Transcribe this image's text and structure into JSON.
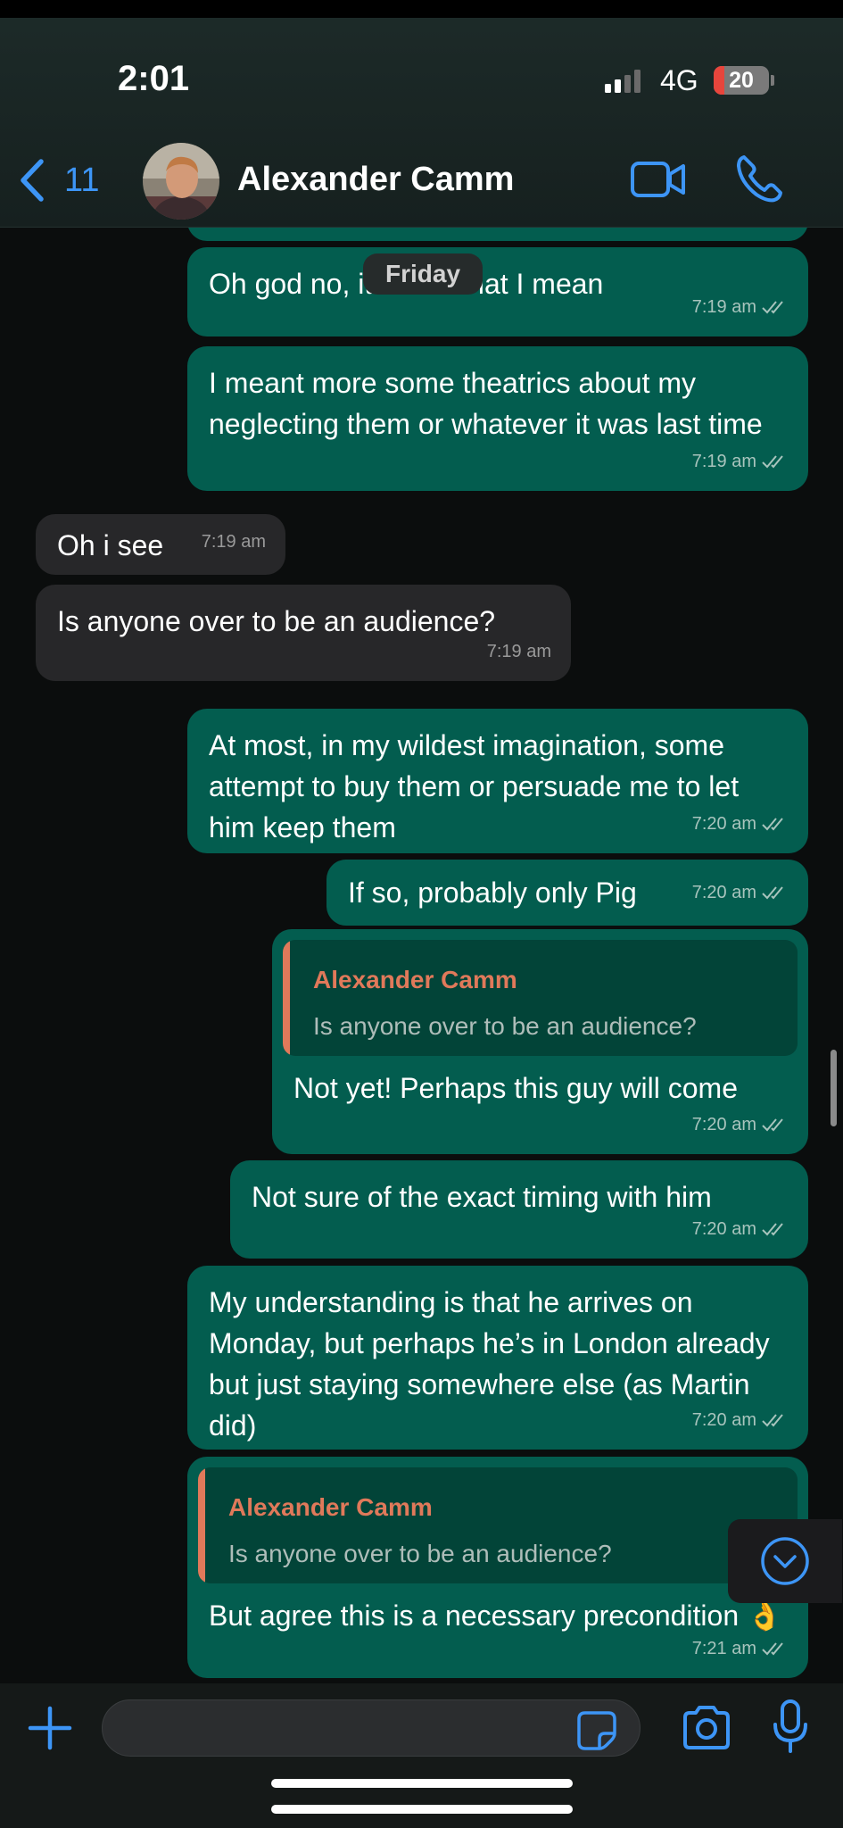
{
  "status_bar": {
    "time": "2:01",
    "network": "4G",
    "battery": "20",
    "battery_level": 0.2
  },
  "header": {
    "back_count": "11",
    "contact_name": "Alexander Camm",
    "icons": [
      "chevron-left-icon",
      "video-camera-icon",
      "phone-icon"
    ]
  },
  "date_pill": "Friday",
  "messages": [
    {
      "dir": "out",
      "text": "Oh god no, it’s not what I mean",
      "time": "7:19 am"
    },
    {
      "dir": "out",
      "text": "I meant more some theatrics about my neglecting them or whatever it was last time",
      "time": "7:19 am"
    },
    {
      "dir": "in",
      "text": "Oh i see",
      "time": "7:19 am"
    },
    {
      "dir": "in",
      "text": "Is anyone over to be an audience?",
      "time": "7:19 am"
    },
    {
      "dir": "out",
      "text": "At most, in my wildest imagination, some attempt to buy them or persuade me to let him keep them",
      "time": "7:20 am"
    },
    {
      "dir": "out",
      "text": "If so, probably only Pig",
      "time": "7:20 am"
    },
    {
      "dir": "out",
      "quote_name": "Alexander Camm",
      "quote_text": "Is anyone over to be an audience?",
      "text": "Not yet! Perhaps this guy will come",
      "time": "7:20 am"
    },
    {
      "dir": "out",
      "text": "Not sure of the exact timing with him",
      "time": "7:20 am"
    },
    {
      "dir": "out",
      "text": "My understanding is that he arrives on Monday, but perhaps he’s in London already but just staying somewhere else (as Martin did)",
      "time": "7:20 am"
    },
    {
      "dir": "out",
      "quote_name": "Alexander Camm",
      "quote_text": "Is anyone over to be an audience?",
      "text": "But agree this is a necessary precondition 👌",
      "time": "7:21 am"
    }
  ],
  "composer": {
    "value": "",
    "icons": [
      "plus-icon",
      "sticker-icon",
      "camera-icon",
      "microphone-icon"
    ]
  },
  "colors": {
    "accent": "#3d95f6",
    "outgoing_bubble": "#035d4f",
    "incoming_bubble": "#272729",
    "quote_name": "#e0795a",
    "background": "#0b0d0d"
  }
}
